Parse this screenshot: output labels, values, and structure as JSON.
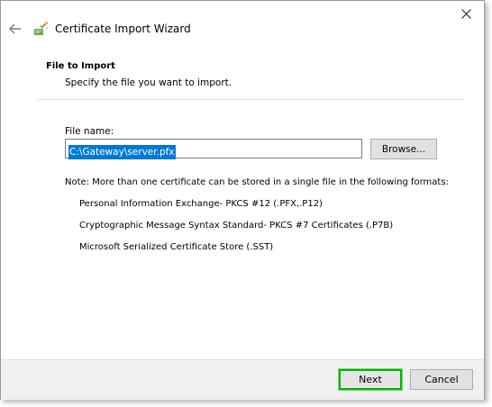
{
  "window": {
    "title": "Certificate Import Wizard",
    "close_icon": "close-icon",
    "back_icon": "back-arrow-icon",
    "wizard_icon": "certificate-wizard-icon"
  },
  "header": {
    "heading": "File to Import",
    "description": "Specify the file you want to import."
  },
  "file": {
    "label": "File name:",
    "value": "C:\\Gateway\\server.pfx",
    "browse_label": "Browse..."
  },
  "note": {
    "text": "Note:  More than one certificate can be stored in a single file in the following formats:",
    "formats": [
      "Personal Information Exchange- PKCS #12 (.PFX,.P12)",
      "Cryptographic Message Syntax Standard- PKCS #7 Certificates (.P7B)",
      "Microsoft Serialized Certificate Store (.SST)"
    ]
  },
  "footer": {
    "next_label": "Next",
    "cancel_label": "Cancel"
  },
  "colors": {
    "selection": "#0078d7",
    "highlight_border": "#00b400",
    "footer_bg": "#f0f0f0"
  }
}
